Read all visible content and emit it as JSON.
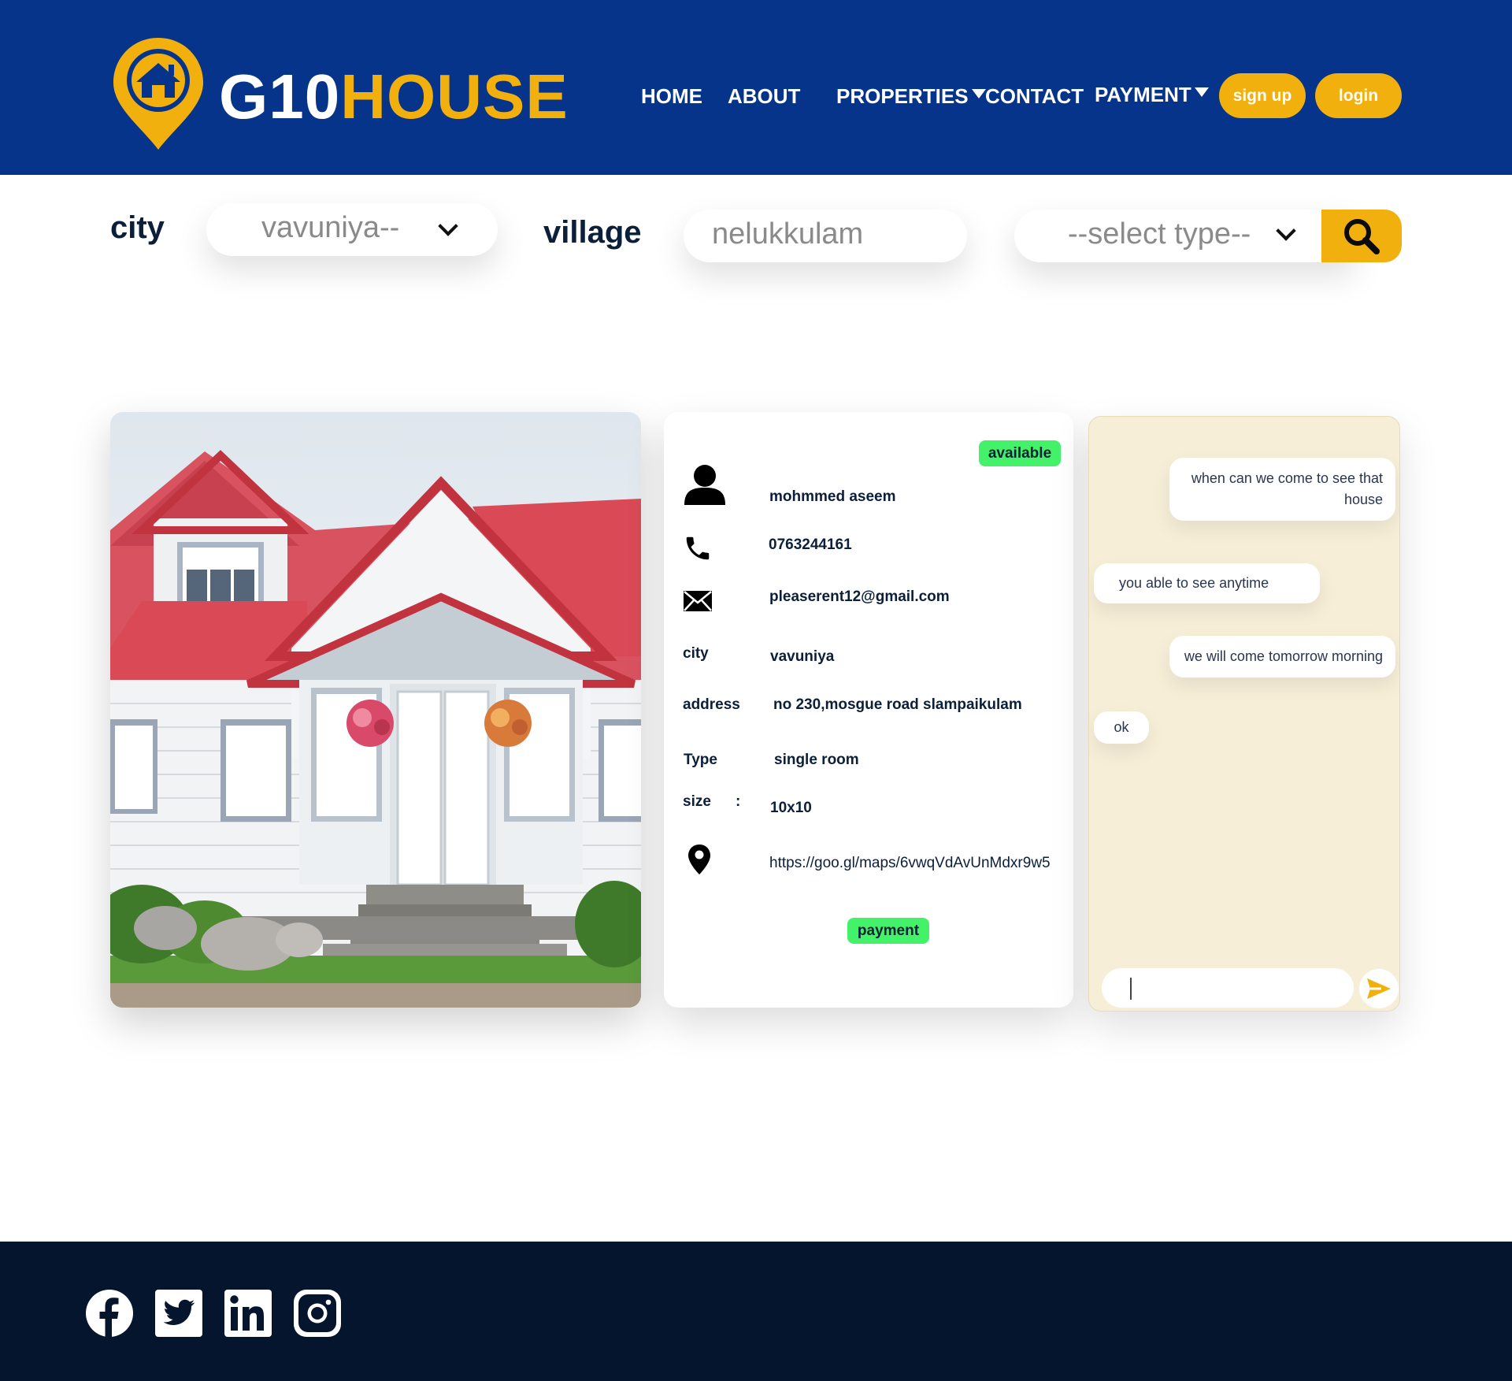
{
  "brand": {
    "part1": "G10",
    "part2": "HOUSE"
  },
  "nav": {
    "home": "HOME",
    "about": "ABOUT",
    "properties": "PROPERTIES",
    "contact": "CONTACT",
    "payment": "PAYMENT",
    "signup": "sign up",
    "login": "login"
  },
  "search": {
    "city_label": "city",
    "city_value": "vavuniya--",
    "village_label": "village",
    "village_value": "nelukkulam",
    "type_value": "--select type--"
  },
  "listing": {
    "status": "available",
    "owner": "mohmmed aseem",
    "phone": "0763244161",
    "email": "pleaserent12@gmail.com",
    "city_key": "city",
    "city": "vavuniya",
    "address_key": "address",
    "address": "no 230,mosgue road slampaikulam",
    "type_key": "Type",
    "type": "single room",
    "size_key": "size",
    "size_sep": ":",
    "size": "10x10",
    "map_link": "https://goo.gl/maps/6vwqVdAvUnMdxr9w5",
    "payment_label": "payment"
  },
  "chat": {
    "messages": [
      {
        "dir": "out",
        "text": "when can we come to see that house"
      },
      {
        "dir": "in",
        "text": "you able to see anytime"
      },
      {
        "dir": "out",
        "text": "we will come tomorrow morning"
      },
      {
        "dir": "in",
        "text": "ok"
      }
    ],
    "input_value": ""
  },
  "footer": {
    "social": [
      "facebook-icon",
      "twitter-icon",
      "linkedin-icon",
      "instagram-icon"
    ]
  },
  "colors": {
    "header_bg": "#05348a",
    "accent": "#f2b00f",
    "badge_green": "#44f26a",
    "footer_bg": "#06152e",
    "chat_bg": "#f6eed7"
  }
}
